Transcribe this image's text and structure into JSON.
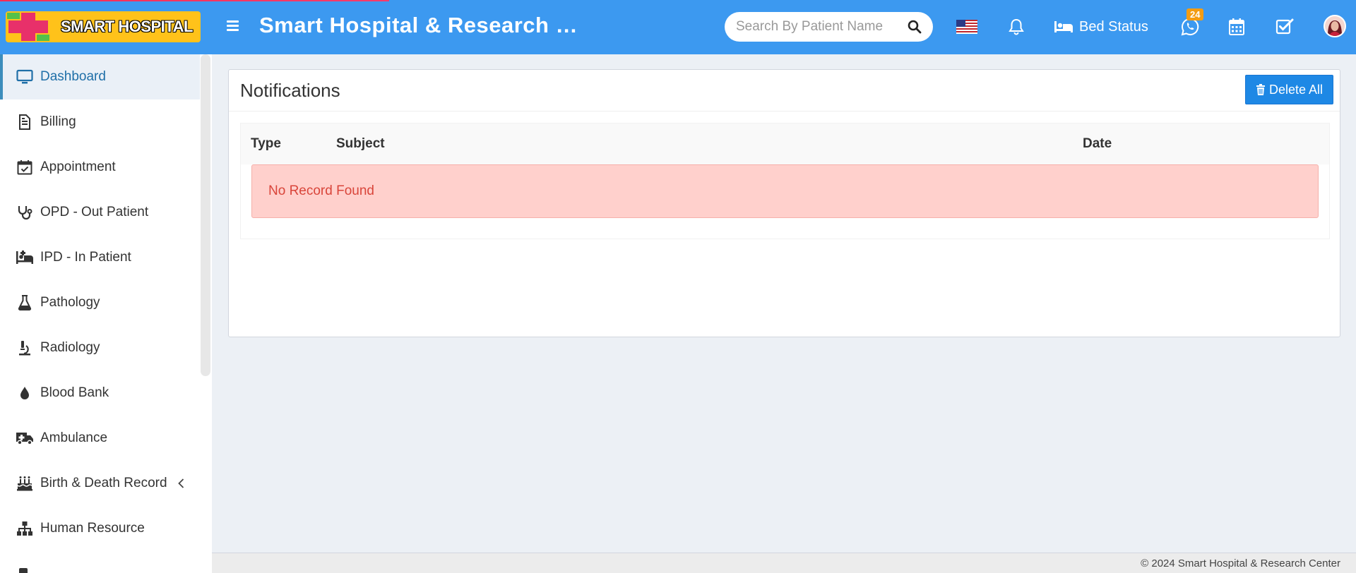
{
  "header": {
    "logo_text": "SMART HOSPITAL",
    "title": "Smart Hospital & Research Center",
    "search_placeholder": "Search By Patient Name",
    "bed_status_label": "Bed Status",
    "chat_badge": "24",
    "icons": [
      "menu-icon",
      "search-icon",
      "us-flag-icon",
      "bell-icon",
      "bed-icon",
      "whatsapp-icon",
      "calendar-icon",
      "task-check-icon",
      "user-avatar"
    ],
    "bg_color": "#3c99f0"
  },
  "sidebar": {
    "items": [
      {
        "label": "Dashboard",
        "icon": "monitor-icon",
        "active": true
      },
      {
        "label": "Billing",
        "icon": "invoice-icon"
      },
      {
        "label": "Appointment",
        "icon": "calendar-check-icon"
      },
      {
        "label": "OPD - Out Patient",
        "icon": "stethoscope-icon"
      },
      {
        "label": "IPD - In Patient",
        "icon": "hospital-bed-icon"
      },
      {
        "label": "Pathology",
        "icon": "flask-icon"
      },
      {
        "label": "Radiology",
        "icon": "microscope-icon"
      },
      {
        "label": "Blood Bank",
        "icon": "blood-drop-icon"
      },
      {
        "label": "Ambulance",
        "icon": "ambulance-icon"
      },
      {
        "label": "Birth & Death Record",
        "icon": "birthday-cake-icon",
        "has_children": true
      },
      {
        "label": "Human Resource",
        "icon": "sitemap-icon"
      }
    ]
  },
  "main": {
    "panel_title": "Notifications",
    "delete_all_label": "Delete All",
    "table": {
      "columns": [
        "Type",
        "Subject",
        "Date"
      ],
      "empty_message": "No Record Found"
    }
  },
  "footer": {
    "copyright": "© 2024 Smart Hospital & Research Center"
  }
}
